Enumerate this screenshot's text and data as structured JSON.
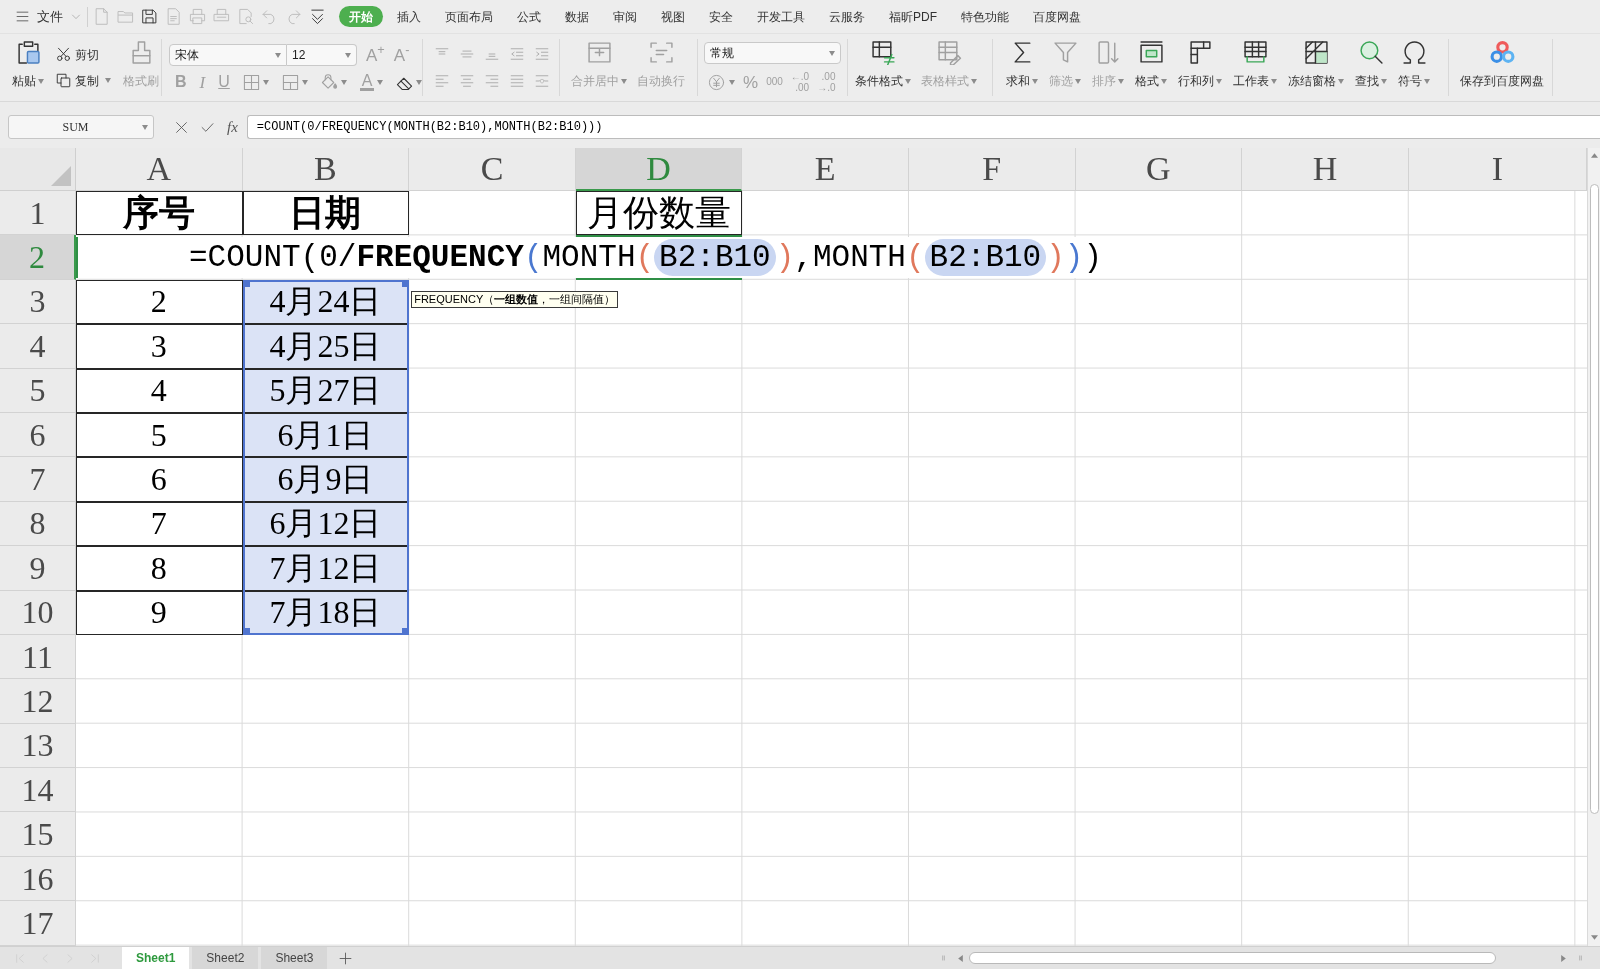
{
  "menu_bar": {
    "file_menu": "文件",
    "quick_access": [
      {
        "disabled": true
      },
      {
        "disabled": true
      },
      {
        "disabled": false
      },
      {
        "disabled": true
      },
      {
        "disabled": true
      },
      {
        "disabled": true
      },
      {
        "disabled": true
      },
      {
        "disabled": true
      },
      {
        "disabled": true
      },
      {
        "disabled": false
      }
    ],
    "tabs": [
      {
        "label": "开始",
        "selected": true
      },
      {
        "label": "插入",
        "selected": false
      },
      {
        "label": "页面布局",
        "selected": false
      },
      {
        "label": "公式",
        "selected": false
      },
      {
        "label": "数据",
        "selected": false
      },
      {
        "label": "审阅",
        "selected": false
      },
      {
        "label": "视图",
        "selected": false
      },
      {
        "label": "安全",
        "selected": false
      },
      {
        "label": "开发工具",
        "selected": false
      },
      {
        "label": "云服务",
        "selected": false
      },
      {
        "label": "福昕PDF",
        "selected": false
      },
      {
        "label": "特色功能",
        "selected": false
      },
      {
        "label": "百度网盘",
        "selected": false
      }
    ]
  },
  "ribbon": {
    "clipboard": [
      {
        "kind": "large",
        "label": "粘贴",
        "dropdown": true,
        "disabled": false
      },
      {
        "kind": "small",
        "label": "剪切",
        "dropdown": false,
        "disabled": false
      },
      {
        "kind": "small",
        "label": "复制",
        "dropdown": true,
        "disabled": false
      },
      {
        "kind": "large",
        "label": "格式刷",
        "dropdown": false,
        "disabled": true
      }
    ],
    "font": {
      "name": "宋体",
      "size": "12",
      "tools": [
        {
          "text": "A$^{+}$",
          "dropdown": false,
          "disabled": true
        },
        {
          "text": "A$^{-}$",
          "dropdown": false,
          "disabled": true
        },
        {
          "text": "B",
          "dropdown": false,
          "disabled": true
        },
        {
          "text": "I",
          "dropdown": false,
          "disabled": true
        },
        {
          "text": "U",
          "dropdown": false,
          "disabled": true
        },
        {
          "dropdown": true,
          "disabled": true
        },
        {
          "dropdown": true,
          "disabled": true
        },
        {
          "dropdown": true,
          "disabled": true
        },
        {
          "text": "A",
          "dropdown": true,
          "disabled": true
        },
        {
          "dropdown": true,
          "disabled": false
        }
      ]
    },
    "alignment": [
      {
        "disabled": true
      },
      {
        "disabled": true
      },
      {
        "disabled": true
      },
      {
        "disabled": true
      },
      {
        "disabled": true
      },
      {
        "disabled": true
      },
      {
        "disabled": true
      },
      {
        "disabled": true
      },
      {
        "disabled": true
      },
      {
        "disabled": true
      }
    ],
    "cells": [
      {
        "label": "合并居中",
        "dropdown": true,
        "disabled": true
      },
      {
        "label": "自动换行",
        "dropdown": false,
        "disabled": true
      }
    ],
    "number": {
      "format": "常规",
      "tools": [
        {
          "kind": "icon",
          "dropdown": true,
          "disabled": true
        },
        {
          "kind": "glyph",
          "text": "%",
          "disabled": true
        },
        {
          "kind": "glyph",
          "text": "000",
          "disabled": true
        },
        {
          "kind": "stack",
          "lines": [
            "←.0",
            ".00"
          ],
          "disabled": true
        },
        {
          "kind": "stack",
          "lines": [
            ".00",
            "→.0"
          ],
          "disabled": true
        }
      ]
    },
    "styles": [
      {
        "label": "条件格式",
        "dropdown": true,
        "disabled": false
      },
      {
        "label": "表格样式",
        "dropdown": true,
        "disabled": true
      }
    ],
    "editing": [
      {
        "label": "求和",
        "dropdown": true,
        "disabled": false
      },
      {
        "label": "筛选",
        "dropdown": true,
        "disabled": true
      },
      {
        "label": "排序",
        "dropdown": true,
        "disabled": true
      },
      {
        "label": "格式",
        "dropdown": true,
        "disabled": false
      },
      {
        "label": "行和列",
        "dropdown": true,
        "disabled": false
      },
      {
        "label": "工作表",
        "dropdown": true,
        "disabled": false
      },
      {
        "label": "冻结窗格",
        "dropdown": true,
        "disabled": false
      },
      {
        "label": "查找",
        "dropdown": true,
        "disabled": false
      },
      {
        "label": "符号",
        "dropdown": true,
        "disabled": false
      }
    ],
    "cloud": [
      {
        "label": "保存到百度网盘",
        "dropdown": false,
        "disabled": false
      }
    ]
  },
  "formula_bar": {
    "name_box": "SUM",
    "function_button": "fx",
    "formula": "=COUNT(0/FREQUENCY(MONTH(B2:B10),MONTH(B2:B10)))"
  },
  "sheet": {
    "columns": [
      {
        "label": "A",
        "selected": false
      },
      {
        "label": "B",
        "selected": false
      },
      {
        "label": "C",
        "selected": false
      },
      {
        "label": "D",
        "selected": true
      },
      {
        "label": "E",
        "selected": false
      },
      {
        "label": "F",
        "selected": false
      },
      {
        "label": "G",
        "selected": false
      },
      {
        "label": "H",
        "selected": false
      },
      {
        "label": "I",
        "selected": false
      }
    ],
    "rows": [
      {
        "number": "1",
        "selected": false,
        "cells": [
          {
            "text": "序号",
            "bold": true,
            "bordered": true,
            "highlighted": false
          },
          {
            "text": "日期",
            "bold": true,
            "bordered": true,
            "highlighted": false
          },
          null,
          {
            "text": "月份数量",
            "bold": false,
            "bordered": true,
            "highlighted": false
          }
        ]
      },
      {
        "number": "2",
        "selected": true
      },
      {
        "number": "3",
        "selected": false,
        "cells": [
          {
            "text": "2",
            "bold": false,
            "bordered": true,
            "highlighted": false
          },
          {
            "text": "4月24日",
            "bold": false,
            "bordered": true,
            "highlighted": true
          }
        ]
      },
      {
        "number": "4",
        "selected": false,
        "cells": [
          {
            "text": "3",
            "bold": false,
            "bordered": true,
            "highlighted": false
          },
          {
            "text": "4月25日",
            "bold": false,
            "bordered": true,
            "highlighted": true
          }
        ]
      },
      {
        "number": "5",
        "selected": false,
        "cells": [
          {
            "text": "4",
            "bold": false,
            "bordered": true,
            "highlighted": false
          },
          {
            "text": "5月27日",
            "bold": false,
            "bordered": true,
            "highlighted": true
          }
        ]
      },
      {
        "number": "6",
        "selected": false,
        "cells": [
          {
            "text": "5",
            "bold": false,
            "bordered": true,
            "highlighted": false
          },
          {
            "text": "6月1日",
            "bold": false,
            "bordered": true,
            "highlighted": true
          }
        ]
      },
      {
        "number": "7",
        "selected": false,
        "cells": [
          {
            "text": "6",
            "bold": false,
            "bordered": true,
            "highlighted": false
          },
          {
            "text": "6月9日",
            "bold": false,
            "bordered": true,
            "highlighted": true
          }
        ]
      },
      {
        "number": "8",
        "selected": false,
        "cells": [
          {
            "text": "7",
            "bold": false,
            "bordered": true,
            "highlighted": false
          },
          {
            "text": "6月12日",
            "bold": false,
            "bordered": true,
            "highlighted": true
          }
        ]
      },
      {
        "number": "9",
        "selected": false,
        "cells": [
          {
            "text": "8",
            "bold": false,
            "bordered": true,
            "highlighted": false
          },
          {
            "text": "7月12日",
            "bold": false,
            "bordered": true,
            "highlighted": true
          }
        ]
      },
      {
        "number": "10",
        "selected": false,
        "cells": [
          {
            "text": "9",
            "bold": false,
            "bordered": true,
            "highlighted": false
          },
          {
            "text": "7月18日",
            "bold": false,
            "bordered": true,
            "highlighted": true
          }
        ]
      },
      {
        "number": "11",
        "selected": false
      },
      {
        "number": "12",
        "selected": false
      },
      {
        "number": "13",
        "selected": false
      },
      {
        "number": "14",
        "selected": false
      },
      {
        "number": "15",
        "selected": false
      },
      {
        "number": "16",
        "selected": false
      },
      {
        "number": "17",
        "selected": false
      }
    ],
    "cell_editor": {
      "tokens": [
        {
          "kind": "plain",
          "text": "=COUNT(0/"
        },
        {
          "kind": "active_function",
          "text": "FREQUENCY"
        },
        {
          "kind": "paren",
          "text": "(",
          "color": "#4a78d0"
        },
        {
          "kind": "plain",
          "text": "MONTH"
        },
        {
          "kind": "paren",
          "text": "(",
          "color": "#e0785c"
        },
        {
          "kind": "reference",
          "text": "B2:B10"
        },
        {
          "kind": "paren",
          "text": ")",
          "color": "#e0785c"
        },
        {
          "kind": "plain",
          "text": ",MONTH"
        },
        {
          "kind": "paren",
          "text": "(",
          "color": "#e0785c"
        },
        {
          "kind": "reference",
          "text": "B2:B10"
        },
        {
          "kind": "paren",
          "text": ")",
          "color": "#e0785c"
        },
        {
          "kind": "paren",
          "text": ")",
          "color": "#4a78d0"
        },
        {
          "kind": "plain",
          "text": ")"
        }
      ]
    },
    "tooltip": "FREQUENCY（**一组数值**，一组间隔值）"
  },
  "sheet_nav": [
    {
      "disabled": true
    },
    {
      "disabled": true
    },
    {
      "disabled": true
    },
    {
      "disabled": true
    }
  ],
  "sheet_tabs": [
    {
      "label": "Sheet1",
      "selected": true
    },
    {
      "label": "Sheet2",
      "selected": false
    },
    {
      "label": "Sheet3",
      "selected": false
    }
  ]
}
